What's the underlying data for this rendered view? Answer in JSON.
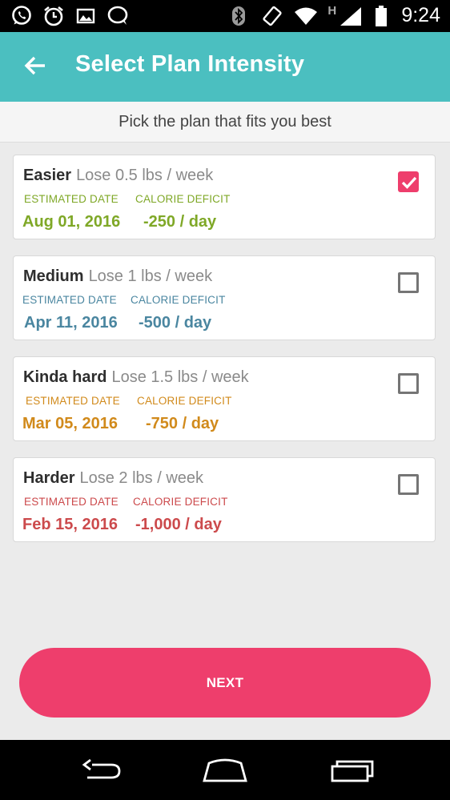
{
  "status_bar": {
    "time": "9:24",
    "network_label": "H",
    "left_icons": [
      "whatsapp-icon",
      "alarm-clock-icon",
      "gallery-icon",
      "chat-bubble-icon"
    ],
    "right_icons": [
      "bluetooth-icon",
      "rotate-icon",
      "wifi-icon",
      "signal-icon",
      "battery-icon"
    ]
  },
  "header": {
    "title": "Select Plan Intensity",
    "accent_color": "#4bbfc0"
  },
  "subtitle": "Pick the plan that fits you best",
  "plans": [
    {
      "name": "Easier",
      "rate": "Lose 0.5 lbs / week",
      "date_label": "ESTIMATED DATE",
      "deficit_label": "CALORIE DEFICIT",
      "date": "Aug 01, 2016",
      "deficit": "-250 / day",
      "color": "#7fa827",
      "checked": true
    },
    {
      "name": "Medium",
      "rate": "Lose 1 lbs / week",
      "date_label": "ESTIMATED DATE",
      "deficit_label": "CALORIE DEFICIT",
      "date": "Apr 11, 2016",
      "deficit": "-500 / day",
      "color": "#4a86a0",
      "checked": false
    },
    {
      "name": "Kinda hard",
      "rate": "Lose 1.5 lbs / week",
      "date_label": "ESTIMATED DATE",
      "deficit_label": "CALORIE DEFICIT",
      "date": "Mar 05, 2016",
      "deficit": "-750 / day",
      "color": "#d18a1b",
      "checked": false
    },
    {
      "name": "Harder",
      "rate": "Lose 2 lbs / week",
      "date_label": "ESTIMATED DATE",
      "deficit_label": "CALORIE DEFICIT",
      "date": "Feb 15, 2016",
      "deficit": "-1,000 / day",
      "color": "#cc4a4c",
      "checked": false
    }
  ],
  "next_button": {
    "label": "NEXT",
    "color": "#ee3e6c"
  },
  "nav_bar": {
    "icons": [
      "back-icon",
      "home-icon",
      "recents-icon"
    ]
  }
}
